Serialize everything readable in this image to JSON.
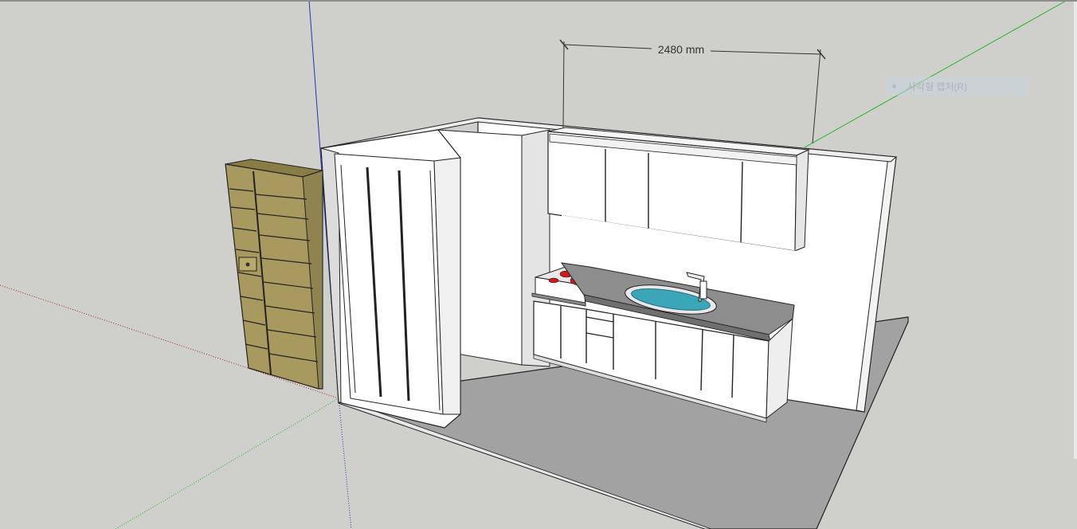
{
  "dimension": {
    "label": "2480 mm"
  },
  "tooltip": {
    "label": "사각형 캡처(R)"
  },
  "colors": {
    "background": "#cfcfcb",
    "floor": "#a2a2a2",
    "wall": "#ffffff",
    "wall_shade": "#eeeeee",
    "wood": "#a89a5f",
    "countertop": "#8d8d8d",
    "sink_water": "#3aa6b8",
    "burner": "#d01818",
    "axis_red": "#b02020",
    "axis_green": "#22bb22",
    "axis_blue": "#2233bb"
  }
}
